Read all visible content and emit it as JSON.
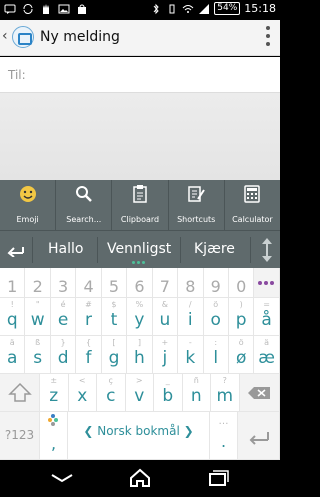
{
  "status_bar": {
    "battery": "54%",
    "time": "15:18"
  },
  "action_bar": {
    "title": "Ny melding",
    "back_icon": "chevron-left-icon",
    "overflow_icon": "overflow-menu-icon"
  },
  "recipient": {
    "label": "Til:"
  },
  "toolbar": {
    "items": [
      {
        "label": "Emoji",
        "icon": "emoji-icon"
      },
      {
        "label": "Search...",
        "icon": "search-icon"
      },
      {
        "label": "Clipboard",
        "icon": "clipboard-icon"
      },
      {
        "label": "Shortcuts",
        "icon": "shortcuts-icon"
      },
      {
        "label": "Calculator",
        "icon": "calculator-icon"
      }
    ]
  },
  "suggestions": {
    "words": [
      "Hallo",
      "Vennligst",
      "Kjære"
    ]
  },
  "keyboard": {
    "numbers": [
      "1",
      "2",
      "3",
      "4",
      "5",
      "6",
      "7",
      "8",
      "9",
      "0"
    ],
    "row1": [
      {
        "ch": "q",
        "alt": "!"
      },
      {
        "ch": "w",
        "alt": "\""
      },
      {
        "ch": "e",
        "alt": "é"
      },
      {
        "ch": "r",
        "alt": "#"
      },
      {
        "ch": "t",
        "alt": "$"
      },
      {
        "ch": "y",
        "alt": "%"
      },
      {
        "ch": "u",
        "alt": "&"
      },
      {
        "ch": "i",
        "alt": "/"
      },
      {
        "ch": "o",
        "alt": "ö"
      },
      {
        "ch": "p",
        "alt": ")"
      },
      {
        "ch": "å",
        "alt": "="
      }
    ],
    "row2": [
      {
        "ch": "a",
        "alt": "ä"
      },
      {
        "ch": "s",
        "alt": "ß"
      },
      {
        "ch": "d",
        "alt": "}"
      },
      {
        "ch": "f",
        "alt": "{"
      },
      {
        "ch": "g",
        "alt": "["
      },
      {
        "ch": "h",
        "alt": "]"
      },
      {
        "ch": "j",
        "alt": "+"
      },
      {
        "ch": "k",
        "alt": "-"
      },
      {
        "ch": "l",
        "alt": ":"
      },
      {
        "ch": "ø",
        "alt": "ö"
      },
      {
        "ch": "æ",
        "alt": "ä"
      }
    ],
    "row3": [
      {
        "ch": "z",
        "alt": "±"
      },
      {
        "ch": "x",
        "alt": "<"
      },
      {
        "ch": "c",
        "alt": "ç"
      },
      {
        "ch": "v",
        "alt": ">"
      },
      {
        "ch": "b",
        "alt": "_"
      },
      {
        "ch": "n",
        "alt": "ñ"
      },
      {
        "ch": "m",
        "alt": "?"
      }
    ],
    "symbols_key": "?123",
    "comma": ",",
    "period": ".",
    "language": "Norsk bokmål",
    "language_left": "❮",
    "language_right": "❯"
  },
  "colors": {
    "accent": "#2e8f9a",
    "toolbar_bg": "#5f6a6c",
    "suggestion_dot": "#4dc19a"
  }
}
